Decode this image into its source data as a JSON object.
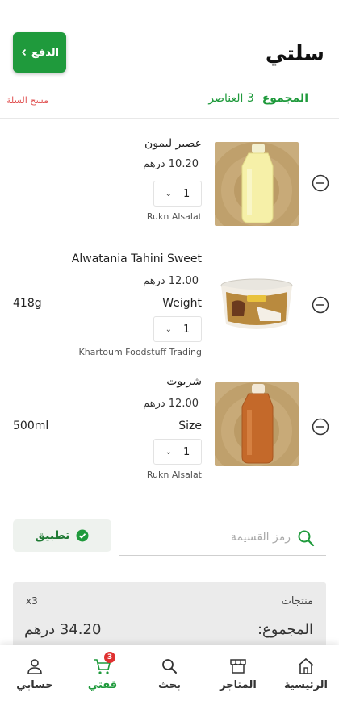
{
  "header": {
    "title": "سلتي",
    "pay_label": "الدفع",
    "total_label": "المجموع",
    "items_count": "3 العناصر",
    "clear_label": "مسح السلة"
  },
  "items": [
    {
      "name": "عصير ليمون",
      "price": "10.20 درهم",
      "quantity": "1",
      "seller": "Rukn Alsalat",
      "image_icon": "lemon-juice-bottle"
    },
    {
      "name": "Alwatania Tahini Sweet",
      "price": "12.00 درهم",
      "variant_label": "Weight",
      "variant_value": "418g",
      "quantity": "1",
      "seller": "Khartoum Foodstuff Trading",
      "image_icon": "tahini-tub"
    },
    {
      "name": "شربوت",
      "price": "12.00 درهم",
      "variant_label": "Size",
      "variant_value": "500ml",
      "quantity": "1",
      "seller": "Rukn Alsalat",
      "image_icon": "sherbet-bottle"
    }
  ],
  "coupon": {
    "placeholder": "رمز القسيمة",
    "apply_label": "تطبيق"
  },
  "summary": {
    "products_label": "منتجات",
    "products_count": "x3",
    "total_label": "المجموع:",
    "total_value": "34.20 درهم"
  },
  "nav": {
    "home": "الرئيسية",
    "stores": "المتاجر",
    "search": "بحث",
    "cart": "قفتي",
    "cart_badge": "3",
    "account": "حسابي"
  },
  "colors": {
    "brand_green": "#1f9a3c",
    "danger_red": "#e05050"
  }
}
